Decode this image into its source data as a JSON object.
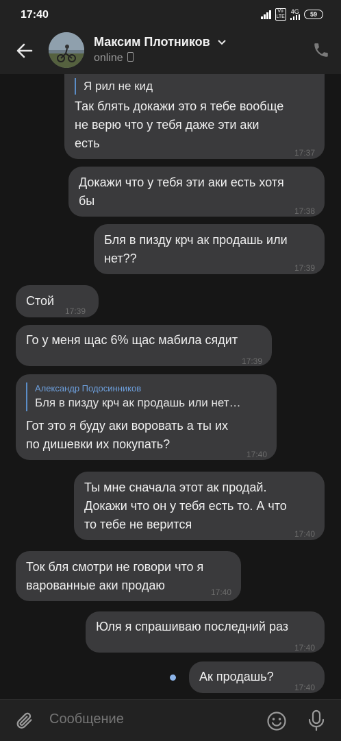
{
  "status_bar": {
    "time": "17:40",
    "volte": "Vo LTE",
    "network": "4G",
    "battery": "59"
  },
  "header": {
    "contact_name": "Максим Плотников",
    "presence": "online"
  },
  "messages": [
    {
      "direction": "in",
      "reply_text": "Я рил не кид",
      "lines": [
        "Так блять докажи это я тебе вообще",
        "не верю что у тебя даже эти аки",
        "есть"
      ],
      "time": "17:37"
    },
    {
      "direction": "out",
      "lines": [
        "Докажи что у тебя эти аки есть хотя",
        "бы"
      ],
      "time": "17:38"
    },
    {
      "direction": "out",
      "lines": [
        "Бля в пизду крч ак продашь или",
        "нет??"
      ],
      "time": "17:39"
    },
    {
      "direction": "in",
      "lines": [
        "Стой"
      ],
      "time": "17:39"
    },
    {
      "direction": "in",
      "lines": [
        "Го у меня щас 6% щас мабила сядит"
      ],
      "time": "17:39"
    },
    {
      "direction": "in",
      "reply_author": "Александр Подосинников",
      "reply_text": "Бля в пизду крч ак продашь или нет…",
      "lines": [
        "Гот это я буду аки воровать а ты их",
        "по дишевки их покупать?"
      ],
      "time": "17:40"
    },
    {
      "direction": "out",
      "lines": [
        "Ты мне сначала этот ак продай.",
        "Докажи что он у тебя есть то. А что",
        "то тебе не верится"
      ],
      "time": "17:40"
    },
    {
      "direction": "in",
      "lines": [
        "Ток бля смотри не говори что я",
        "варованные аки продаю"
      ],
      "time": "17:40"
    },
    {
      "direction": "out",
      "lines": [
        "Юля я спрашиваю последний раз"
      ],
      "time": "17:40"
    },
    {
      "direction": "out",
      "lines": [
        "Ак продашь?"
      ],
      "time": "17:40",
      "unread": true
    }
  ],
  "composer": {
    "placeholder": "Сообщение"
  },
  "colors": {
    "background": "#161616",
    "bar": "#222222",
    "bubble": "#3a3a3c",
    "reply_accent": "#5b8dc7",
    "unread_dot": "#8cb4e8"
  },
  "icons": [
    "back-arrow-icon",
    "chevron-down-icon",
    "mobile-phone-icon",
    "phone-call-icon",
    "paperclip-icon",
    "emoji-icon",
    "microphone-icon"
  ]
}
